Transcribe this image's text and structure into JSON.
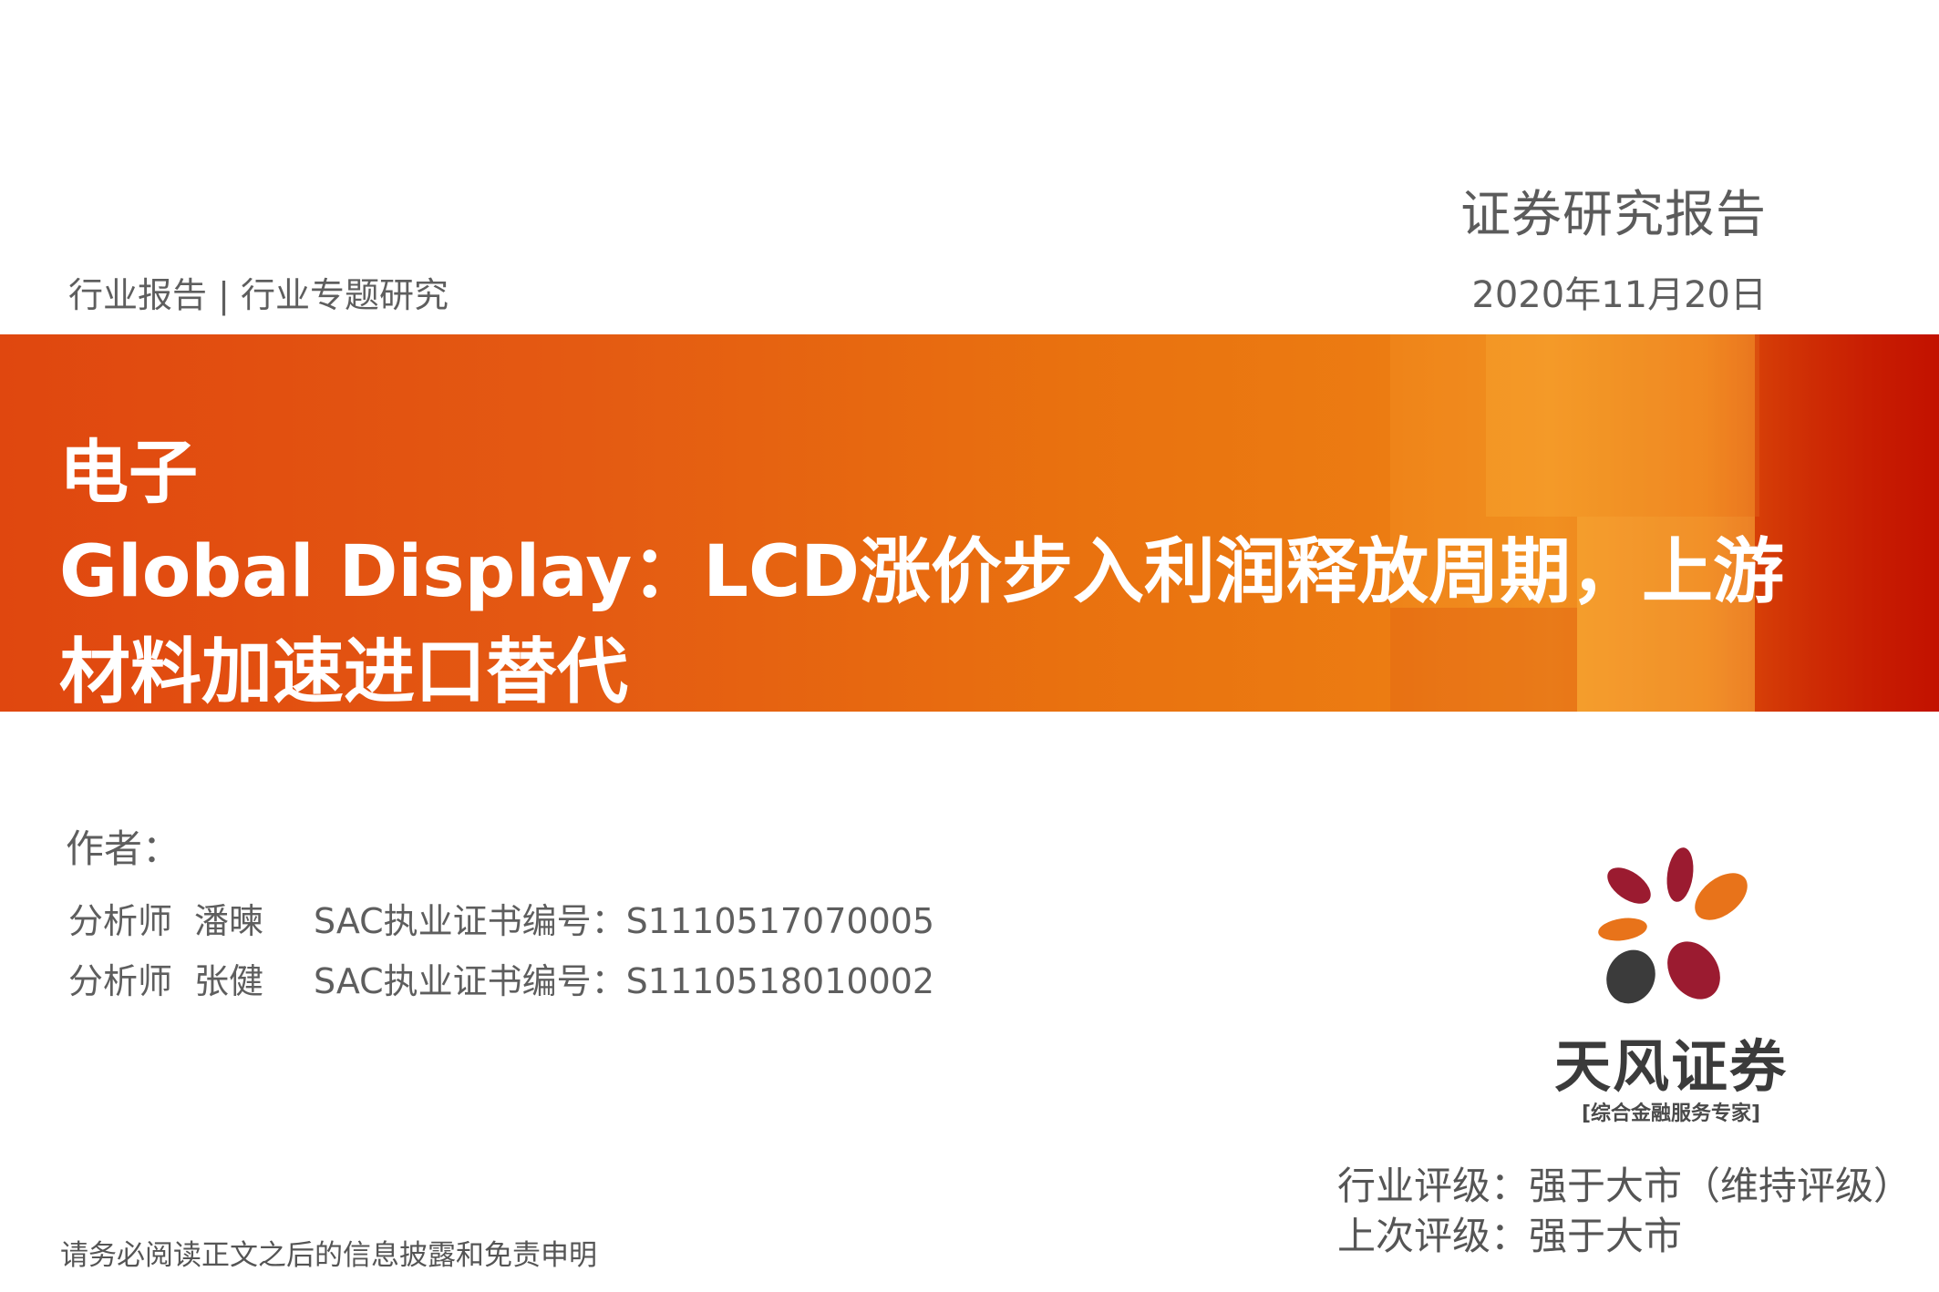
{
  "header": {
    "report_type": "证券研究报告",
    "breadcrumb": "行业报告 | 行业专题研究",
    "date": "2020年11月20日"
  },
  "banner": {
    "sector": "电子",
    "title_line_1": "Global Display：LCD涨价步入利润释放周期，上游",
    "title_line_2": "材料加速进口替代",
    "colors": {
      "primary": "#e45a12",
      "highlight": "#ee8a1a",
      "edge": "#c81e00"
    }
  },
  "authors": {
    "label": "作者：",
    "analysts": [
      {
        "role": "分析师",
        "name": "潘暕",
        "cert": "SAC执业证书编号：S1110517070005"
      },
      {
        "role": "分析师",
        "name": "张健",
        "cert": "SAC执业证书编号：S1110518010002"
      }
    ]
  },
  "logo": {
    "name": "天风证券",
    "tagline": "[综合金融服务专家]",
    "colors": {
      "maroon": "#9b1b30",
      "orange": "#e8731a",
      "dark": "#3b3b3b"
    }
  },
  "ratings": {
    "industry": "行业评级：强于大市（维持评级）",
    "previous": "上次评级：强于大市"
  },
  "footer": {
    "disclaimer": "请务必阅读正文之后的信息披露和免责申明"
  }
}
